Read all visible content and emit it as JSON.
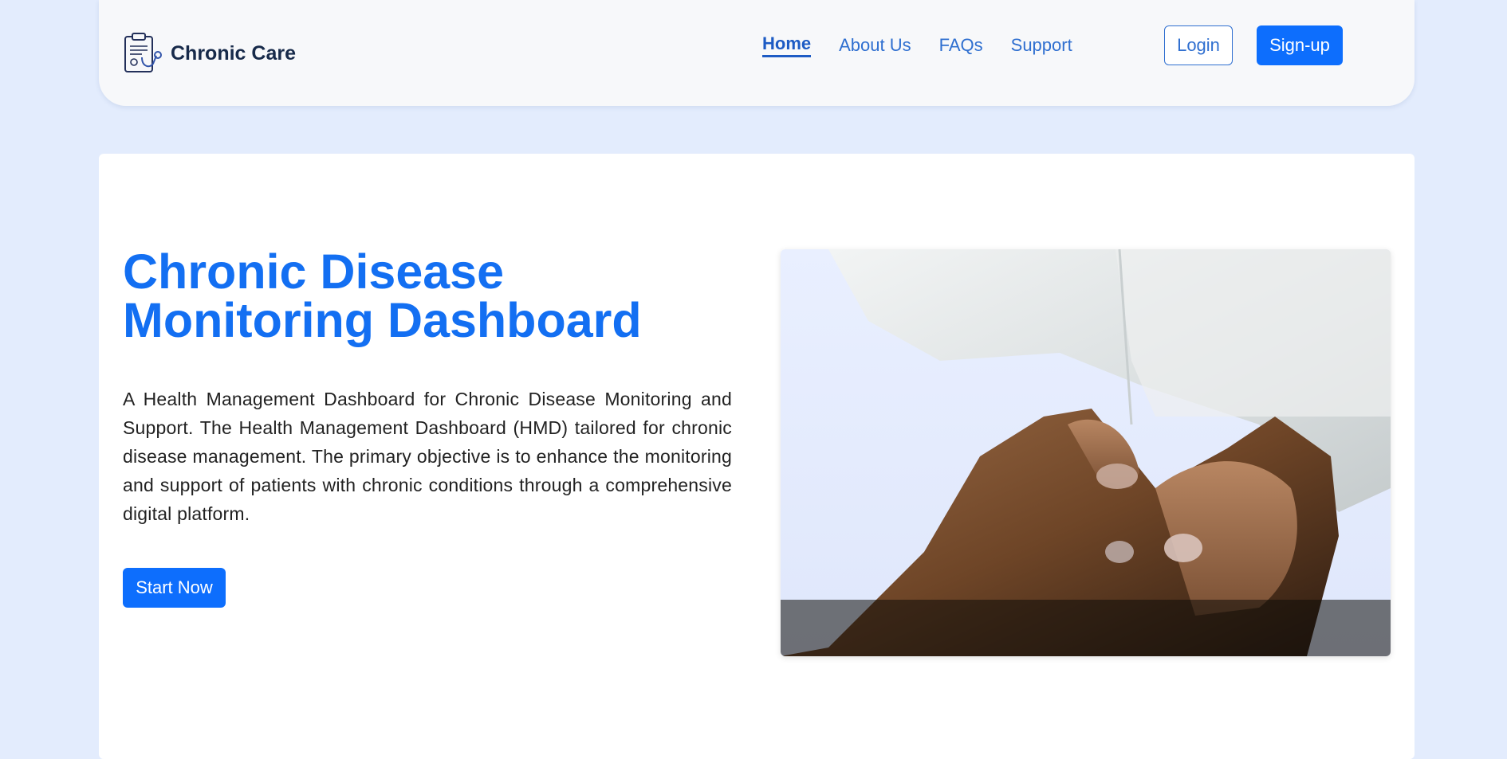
{
  "header": {
    "brand_name": "Chronic Care",
    "brand_icon": "clipboard-stethoscope-icon",
    "nav": [
      {
        "label": "Home",
        "active": true
      },
      {
        "label": "About Us",
        "active": false
      },
      {
        "label": "FAQs",
        "active": false
      },
      {
        "label": "Support",
        "active": false
      }
    ],
    "login_label": "Login",
    "signup_label": "Sign-up"
  },
  "hero": {
    "title_line1": "Chronic Disease",
    "title_line2": "Monitoring Dashboard",
    "description": "A Health Management Dashboard for Chronic Disease Monitoring and Support. The Health Management Dashboard (HMD) tailored for chronic disease management. The primary objective is to enhance the monitoring and support of patients with chronic conditions through a comprehensive digital platform.",
    "cta_label": "Start Now",
    "image": "hands-holding-photo"
  },
  "colors": {
    "page_bg": "#e3ecfd",
    "accent": "#0d6efd",
    "title": "#136ff2",
    "nav_link": "#2f6fd0"
  }
}
